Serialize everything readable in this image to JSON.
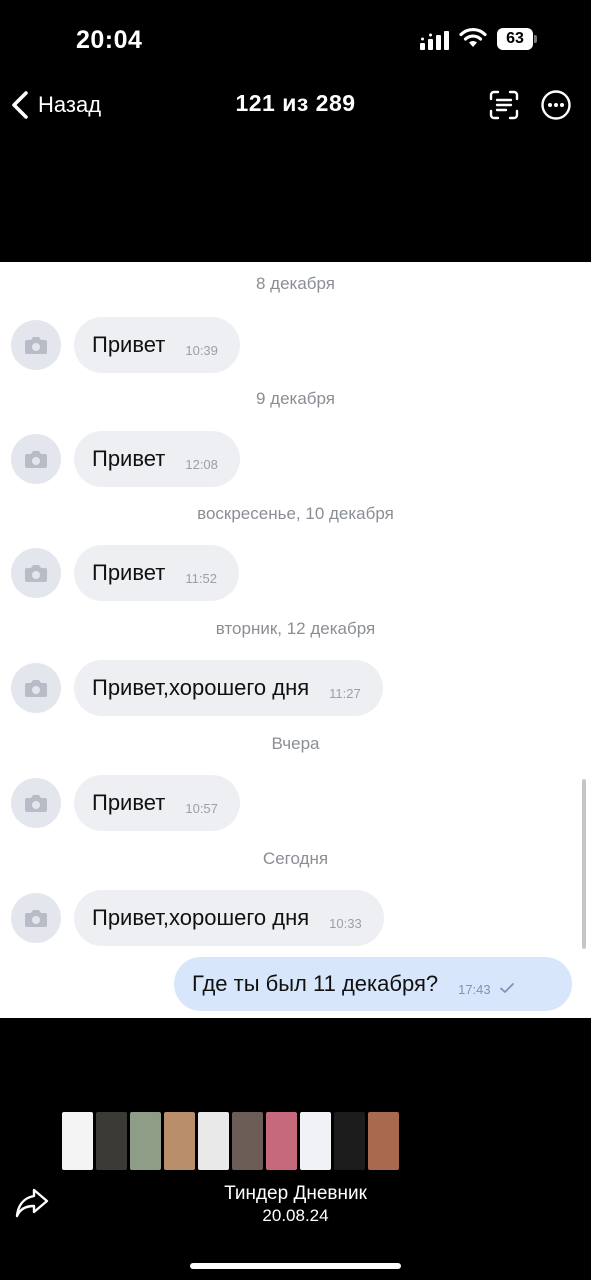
{
  "status_bar": {
    "time": "20:04",
    "battery": "63"
  },
  "nav": {
    "back_label": "Назад",
    "title": "121 из 289"
  },
  "icons": {
    "back": "chevron-left-icon",
    "scan": "text-scan-icon",
    "more": "ellipsis-circle-icon",
    "avatar": "camera-icon",
    "read": "checkmark-icon",
    "share": "share-icon"
  },
  "colors": {
    "background": "#000000",
    "chat_background": "#ffffff",
    "incoming_bubble": "#edeff3",
    "outgoing_bubble": "#d8e6fb",
    "date_text": "#8a8e95"
  },
  "chat": {
    "dates": [
      "8 декабря",
      "9 декабря",
      "воскресенье, 10 декабря",
      "вторник, 12 декабря",
      "Вчера",
      "Сегодня"
    ],
    "messages": [
      {
        "text": "Привет",
        "time": "10:39"
      },
      {
        "text": "Привет",
        "time": "12:08"
      },
      {
        "text": "Привет",
        "time": "11:52"
      },
      {
        "text": "Привет,хорошего дня",
        "time": "11:27"
      },
      {
        "text": "Привет",
        "time": "10:57"
      },
      {
        "text": "Привет,хорошего дня",
        "time": "10:33"
      }
    ],
    "outgoing": {
      "text": "Где ты был 11 декабря?",
      "time": "17:43"
    }
  },
  "caption": {
    "title": "Тиндер Дневник",
    "date": "20.08.24"
  }
}
